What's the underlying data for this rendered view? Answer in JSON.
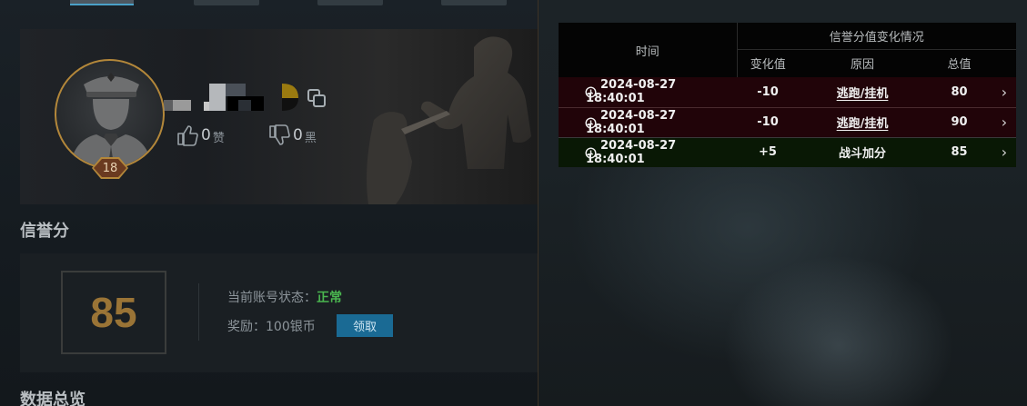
{
  "profile": {
    "level": "18",
    "likes": {
      "count": "0",
      "unit": "赞"
    },
    "dislikes": {
      "count": "0",
      "unit": "黑"
    }
  },
  "credit": {
    "section_title": "信誉分",
    "score": "85",
    "status_label": "当前账号状态：",
    "status_value": "正常",
    "reward_label": "奖励：100银币",
    "claim_button": "领取"
  },
  "data_overview": {
    "section_title": "数据总览"
  },
  "history": {
    "header_time": "时间",
    "header_group": "信誉分值变化情况",
    "header_change": "变化值",
    "header_reason": "原因",
    "header_total": "总值",
    "rows": [
      {
        "time": "2024-08-27 18:40:01",
        "change": "-10",
        "reason": "逃跑/挂机",
        "total": "80",
        "type": "negative"
      },
      {
        "time": "2024-08-27 18:40:01",
        "change": "-10",
        "reason": "逃跑/挂机",
        "total": "90",
        "type": "negative"
      },
      {
        "time": "2024-08-27 18:40:01",
        "change": "+5",
        "reason": "战斗加分",
        "total": "85",
        "type": "positive"
      }
    ]
  },
  "colors": {
    "accent_gold": "#b3873a",
    "status_green": "#4ab54f",
    "button_blue": "#1a6a94",
    "negative_row": "#210409",
    "positive_row": "#091805"
  }
}
